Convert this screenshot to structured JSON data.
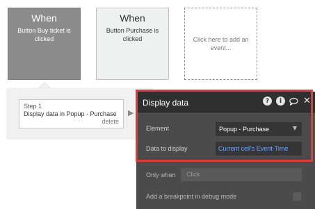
{
  "events": [
    {
      "title": "When",
      "subtitle": "Button Buy ticket is clicked"
    },
    {
      "title": "When",
      "subtitle": "Button Purchase is clicked"
    },
    {
      "placeholder": "Click here to add an event..."
    }
  ],
  "workflow": {
    "step_number": "Step 1",
    "step_action": "Display data in Popup - Purchase",
    "delete_label": "delete",
    "arrow_icon": "triangle-right-icon"
  },
  "inspector": {
    "title": "Display data",
    "icons": [
      "help-icon",
      "info-icon",
      "comment-icon",
      "close-icon"
    ],
    "element_label": "Element",
    "element_value": "Popup - Purchase",
    "data_label": "Data to display",
    "data_value": "Current cell's Event-Time",
    "only_when_label": "Only when",
    "only_when_placeholder": "Click",
    "breakpoint_label": "Add a breakpoint in debug mode",
    "highlight_color": "#e53935"
  }
}
